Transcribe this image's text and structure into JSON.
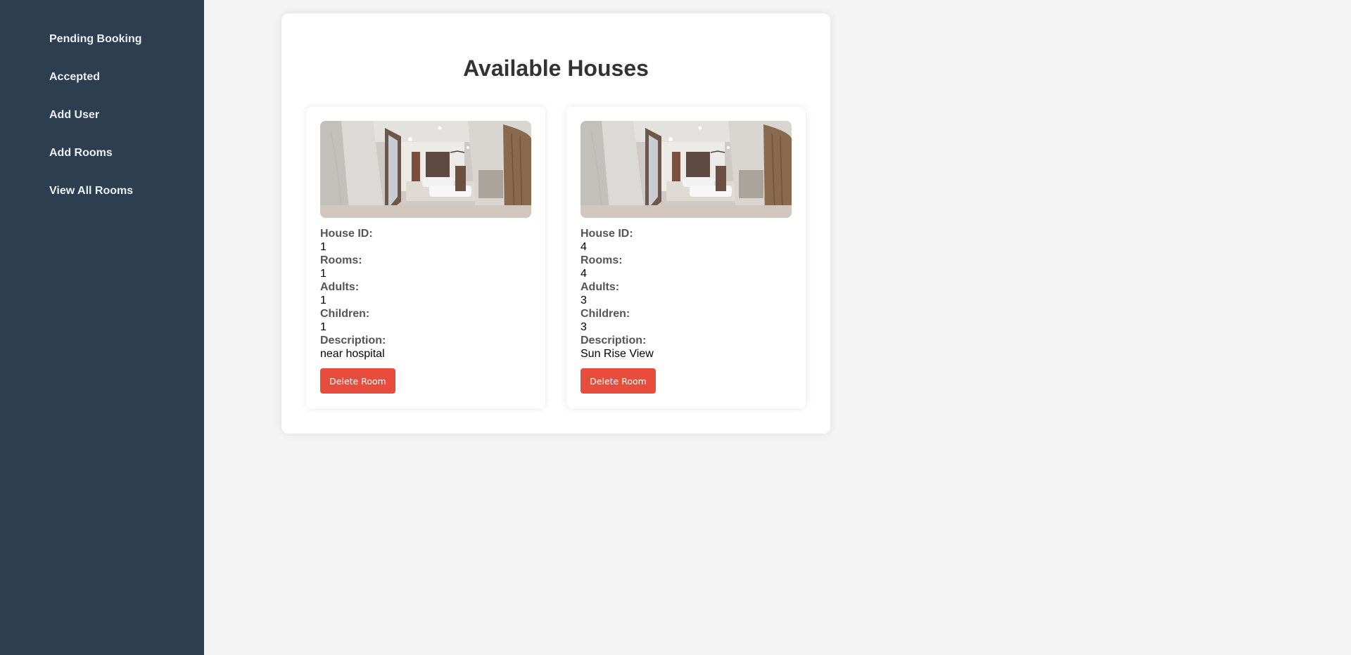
{
  "sidebar": {
    "items": [
      {
        "label": "Pending Booking"
      },
      {
        "label": "Accepted"
      },
      {
        "label": "Add User"
      },
      {
        "label": "Add Rooms"
      },
      {
        "label": "View All Rooms"
      }
    ]
  },
  "main": {
    "title": "Available Houses",
    "houses": [
      {
        "house_id_label": "House ID:",
        "house_id": "1",
        "rooms_label": "Rooms:",
        "rooms": "1",
        "adults_label": "Adults:",
        "adults": "1",
        "children_label": "Children:",
        "children": "1",
        "description_label": "Description:",
        "description": "near hospital",
        "delete_label": "Delete Room"
      },
      {
        "house_id_label": "House ID:",
        "house_id": "4",
        "rooms_label": "Rooms:",
        "rooms": "4",
        "adults_label": "Adults:",
        "adults": "3",
        "children_label": "Children:",
        "children": "3",
        "description_label": "Description:",
        "description": "Sun Rise View",
        "delete_label": "Delete Room"
      }
    ]
  },
  "colors": {
    "sidebar_bg": "#2c3e50",
    "delete_button": "#e74c3c",
    "page_bg": "#f4f4f4"
  }
}
